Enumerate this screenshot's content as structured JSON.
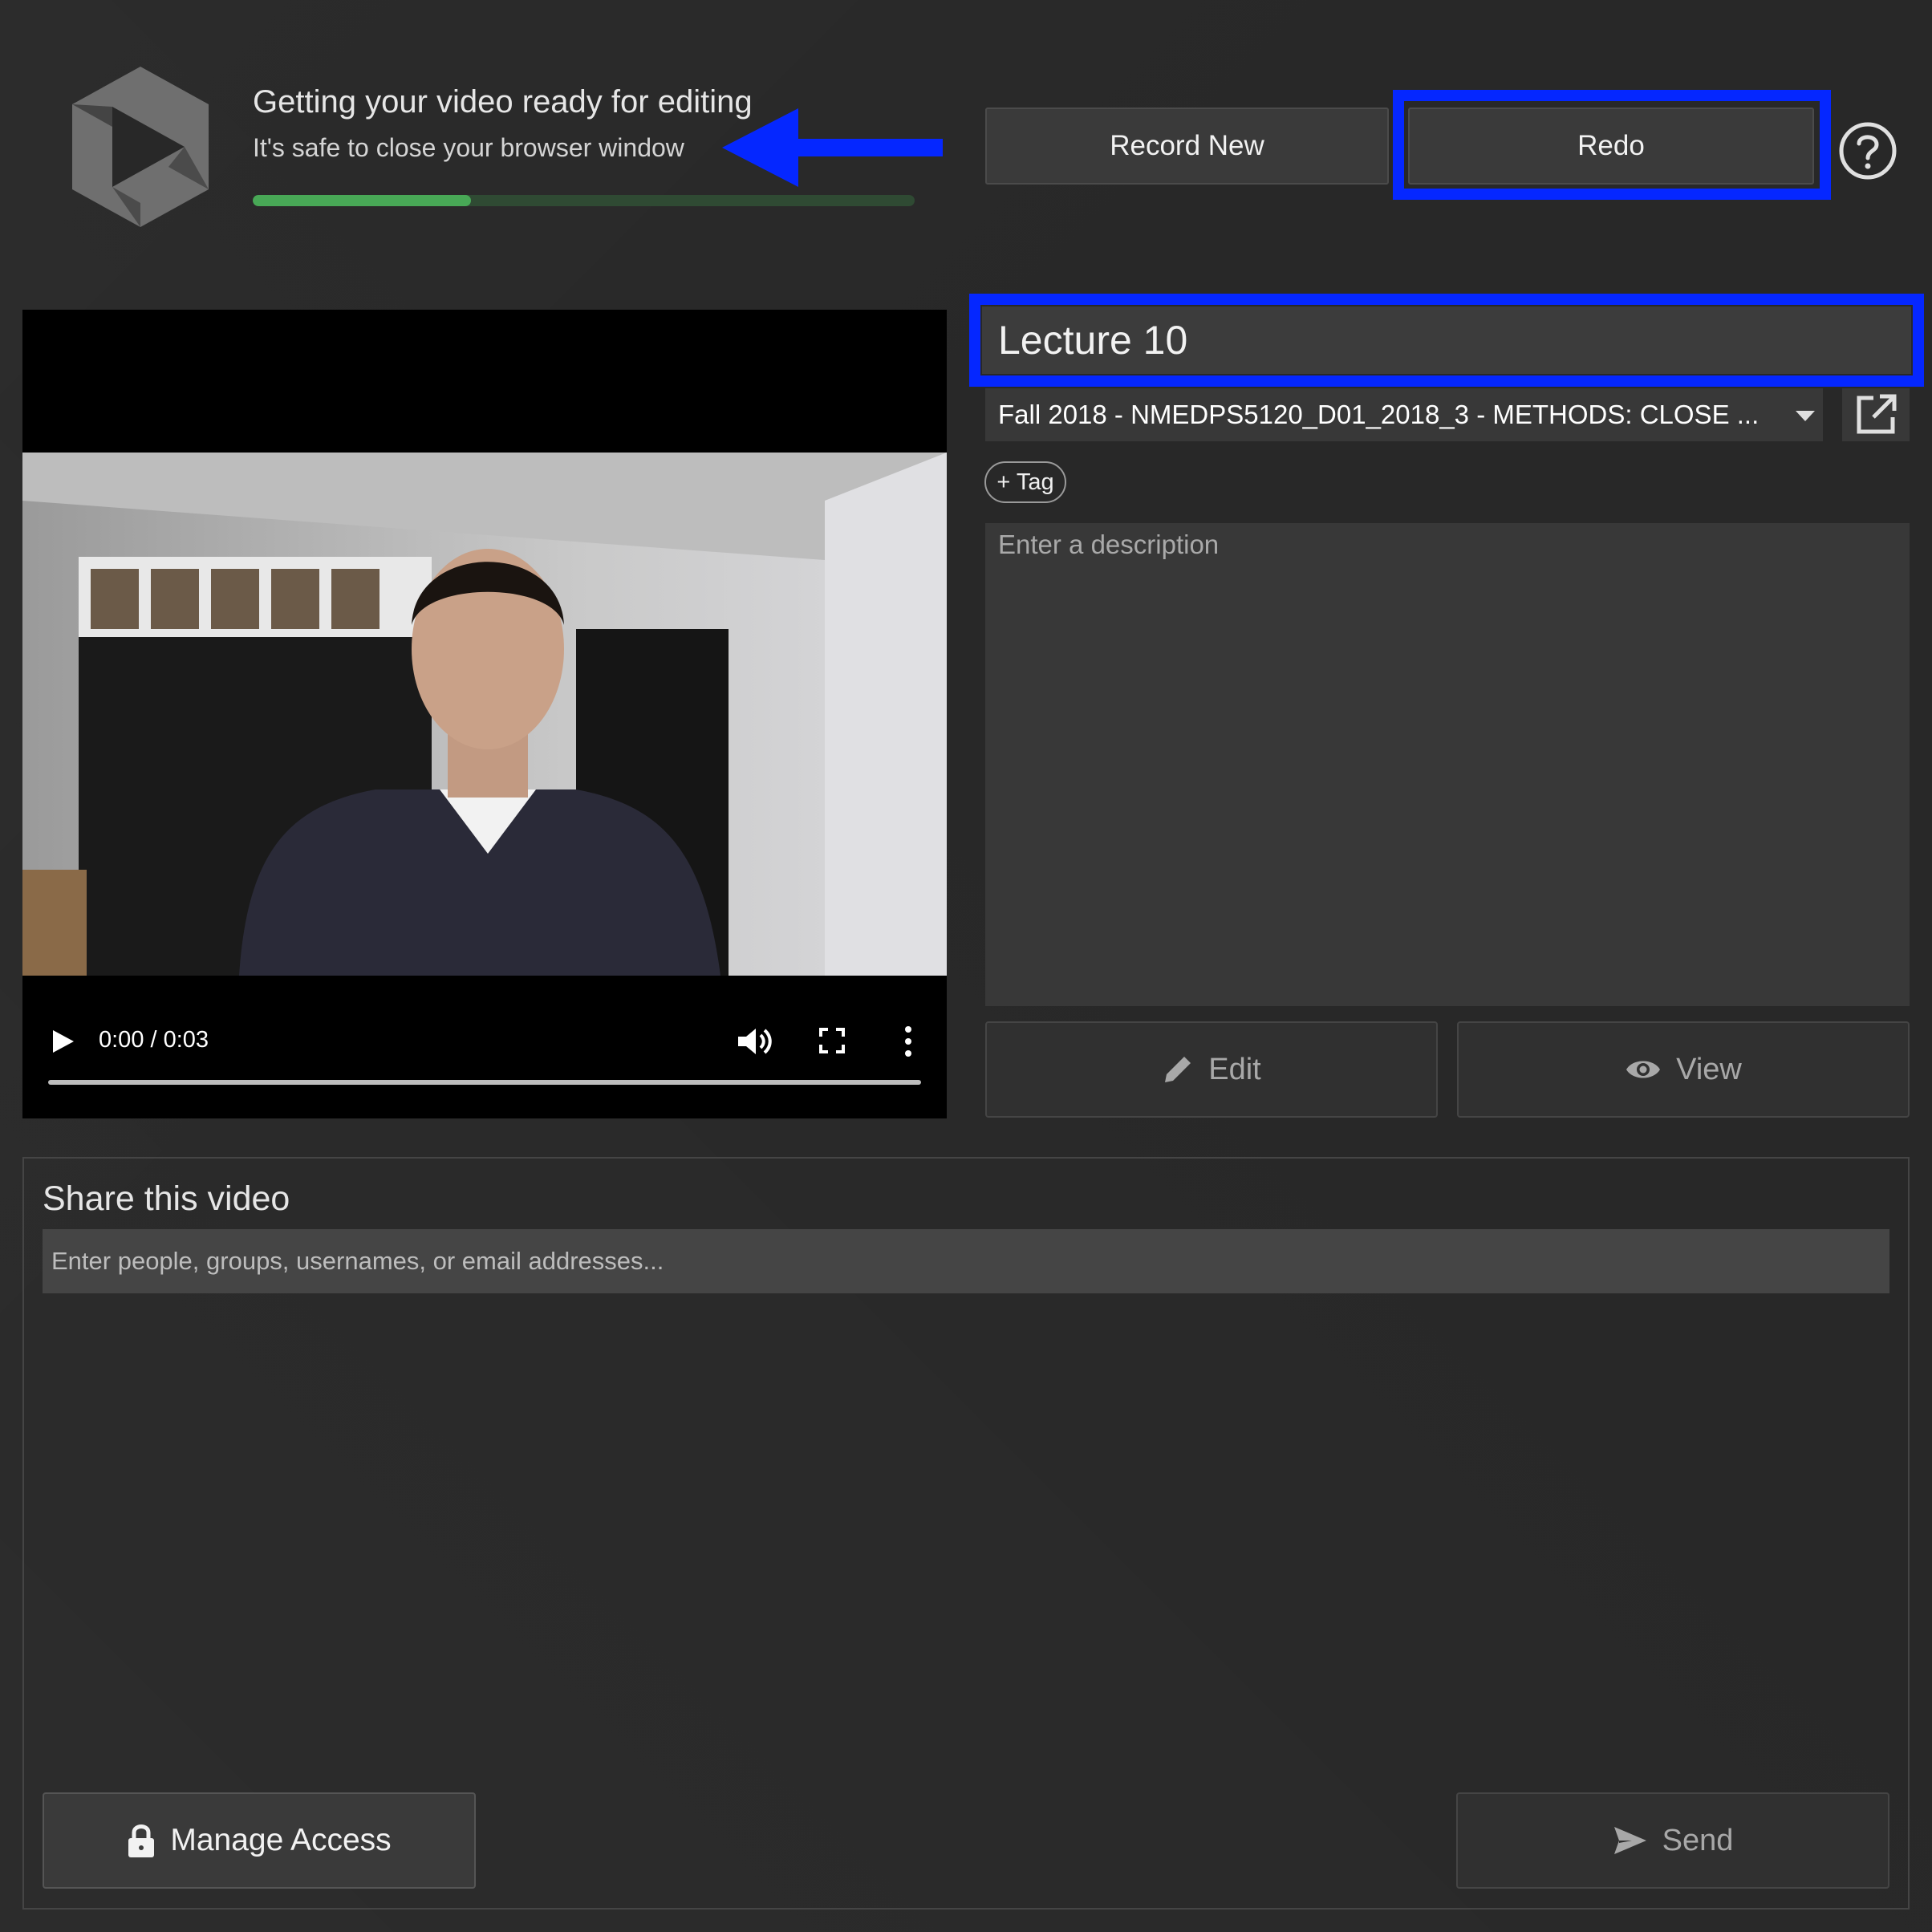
{
  "status": {
    "title": "Getting your video ready for editing",
    "subtitle": "It's safe to close your browser window",
    "progress": 0.33
  },
  "toolbar": {
    "record_new_label": "Record New",
    "redo_label": "Redo",
    "help_icon": "help-circle-icon"
  },
  "player": {
    "time": "0:00 / 0:03",
    "icons": [
      "play-icon",
      "volume-icon",
      "fullscreen-icon",
      "more-vertical-icon"
    ]
  },
  "details": {
    "title_value": "Lecture 10",
    "folder": "Fall 2018 - NMEDPS5120_D01_2018_3 - METHODS: CLOSE ...",
    "tag_label": "+ Tag",
    "description_placeholder": "Enter a description",
    "edit_label": "Edit",
    "view_label": "View"
  },
  "share": {
    "title": "Share this video",
    "input_placeholder": "Enter people, groups, usernames, or email addresses...",
    "manage_access_label": "Manage Access",
    "send_label": "Send"
  },
  "colors": {
    "highlight": "#0527ff",
    "progress": "#48a856",
    "background": "#282828"
  }
}
